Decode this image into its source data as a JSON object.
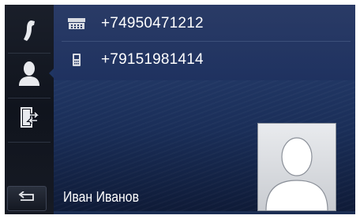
{
  "sidebar": {
    "items": [
      {
        "icon": "phone-handset-icon",
        "name": "phone"
      },
      {
        "icon": "contact-person-icon",
        "name": "contact",
        "selected": true
      },
      {
        "icon": "contact-transfer-icon",
        "name": "transfer"
      }
    ],
    "back_icon": "back-arrow-icon"
  },
  "contact": {
    "numbers": [
      {
        "type_icon": "landline-phone-icon",
        "number": "+74950471212"
      },
      {
        "type_icon": "mobile-phone-icon",
        "number": "+79151981414"
      }
    ],
    "name": "Иван  Иванов",
    "photo_icon": "contact-silhouette-icon"
  },
  "colors": {
    "accent": "#223866",
    "text": "#ffffff",
    "sidebar": "#141822"
  }
}
